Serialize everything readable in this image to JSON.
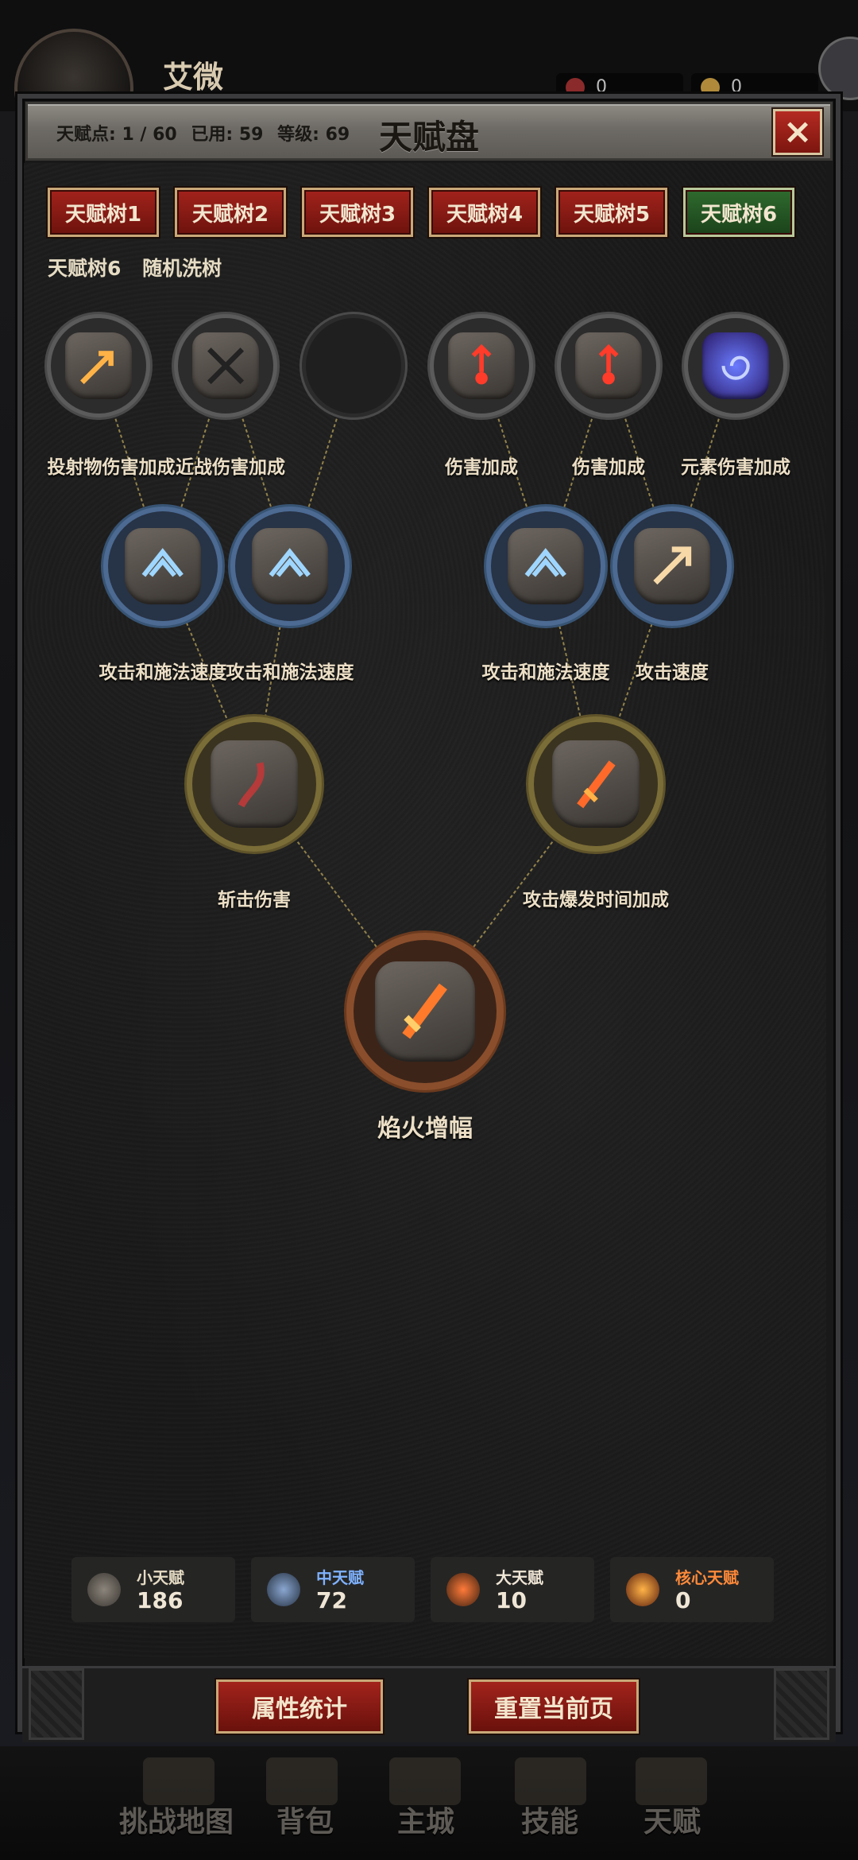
{
  "hud": {
    "player_name": "艾微",
    "res1": "0",
    "res2": "0"
  },
  "panel": {
    "title": "天赋盘",
    "stats": {
      "points": "天赋点: 1 / 60",
      "used": "已用: 59",
      "level": "等级: 69"
    },
    "close_icon": "×"
  },
  "tabs": [
    {
      "label": "天赋树1",
      "active": false
    },
    {
      "label": "天赋树2",
      "active": false
    },
    {
      "label": "天赋树3",
      "active": false
    },
    {
      "label": "天赋树4",
      "active": false
    },
    {
      "label": "天赋树5",
      "active": false
    },
    {
      "label": "天赋树6",
      "active": true
    }
  ],
  "subtitle": {
    "tree_name": "天赋树6",
    "reroll": "随机洗树"
  },
  "nodes": {
    "minor": [
      {
        "label": "投射物伤害加成",
        "icon": "arrow-icon"
      },
      {
        "label": "近战伤害加成",
        "icon": "crossed-swords-icon"
      },
      {
        "label": "",
        "icon": "empty-slot"
      },
      {
        "label": "伤害加成",
        "icon": "skull-arrow-icon"
      },
      {
        "label": "伤害加成",
        "icon": "skull-arrow-icon"
      },
      {
        "label": "元素伤害加成",
        "icon": "vortex-icon"
      }
    ],
    "medium": [
      {
        "label": "攻击和施法速度",
        "icon": "wing-rune-icon"
      },
      {
        "label": "攻击和施法速度",
        "icon": "wing-rune-icon"
      },
      {
        "label": "攻击和施法速度",
        "icon": "wing-rune-icon"
      },
      {
        "label": "攻击速度",
        "icon": "arrow-rune-icon"
      }
    ],
    "major": [
      {
        "label": "斩击伤害",
        "icon": "scythe-icon"
      },
      {
        "label": "攻击爆发时间加成",
        "icon": "flame-sword-icon"
      }
    ],
    "core": {
      "label": "焰火增幅",
      "icon": "flame-dagger-icon"
    }
  },
  "counters": [
    {
      "name": "小天赋",
      "value": "186",
      "color": "#e6dcc4"
    },
    {
      "name": "中天赋",
      "value": "72",
      "color": "#7fb2ff"
    },
    {
      "name": "大天赋",
      "value": "10",
      "color": "#f0e6d6"
    },
    {
      "name": "核心天赋",
      "value": "0",
      "color": "#ff8a3a"
    }
  ],
  "actions": {
    "stats": "属性统计",
    "reset": "重置当前页"
  },
  "nav": [
    "挑战地图",
    "背包",
    "主城",
    "技能",
    "天赋"
  ]
}
